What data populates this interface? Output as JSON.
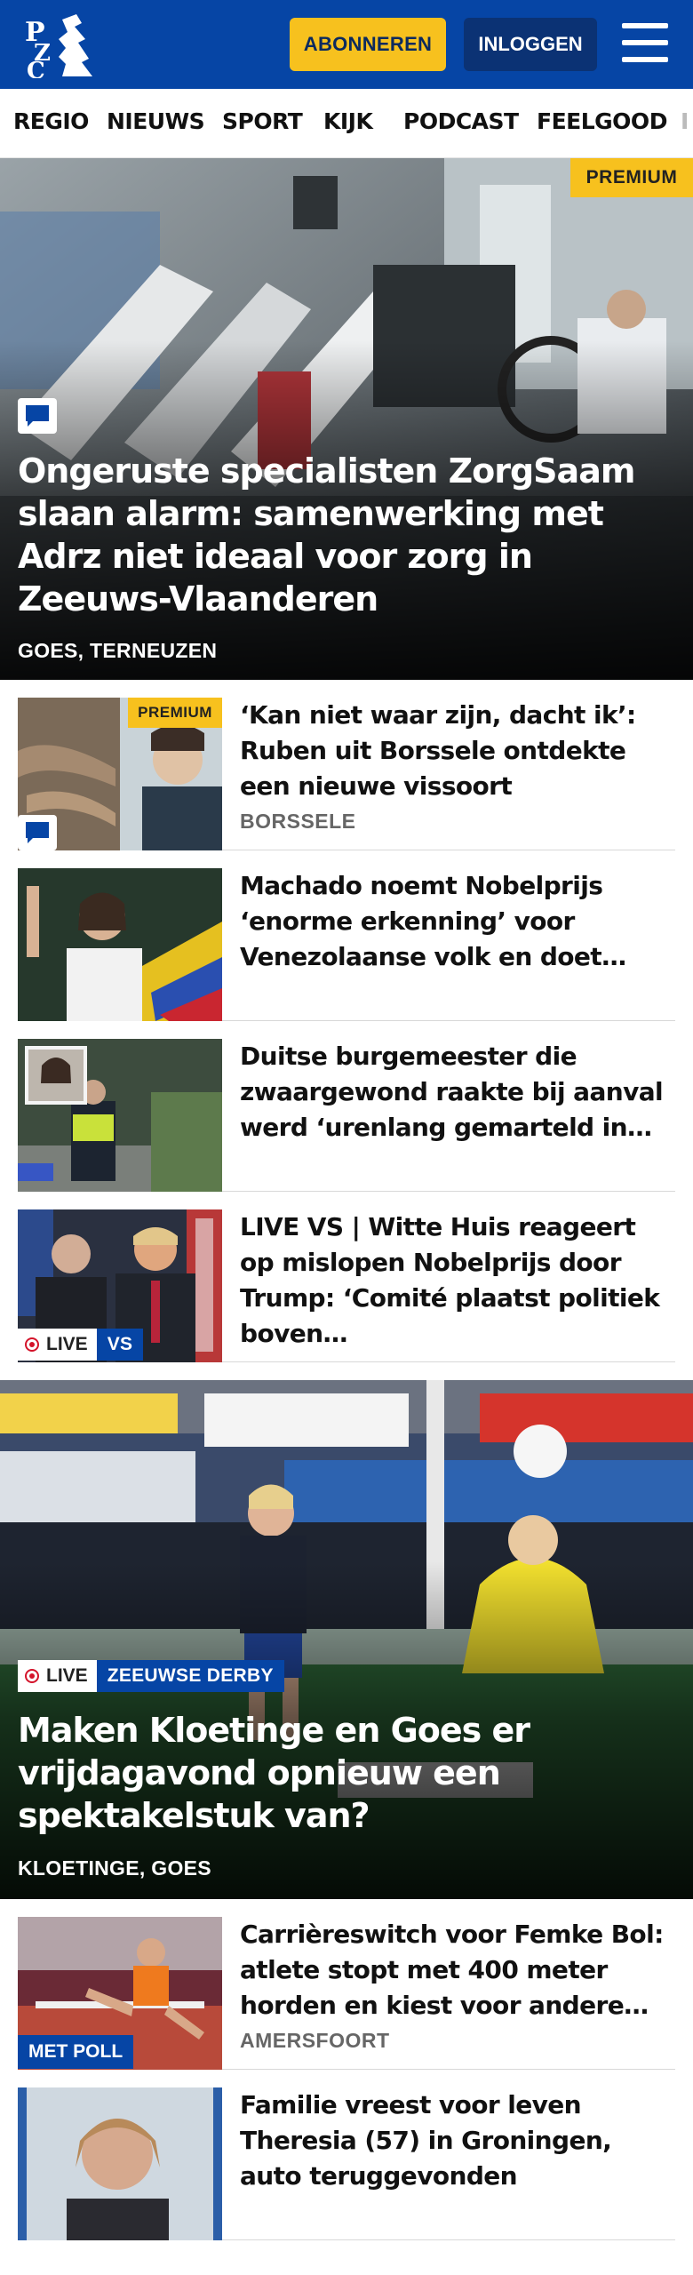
{
  "header": {
    "logo_text": "PZC",
    "subscribe_label": "ABONNEREN",
    "login_label": "INLOGGEN"
  },
  "nav": {
    "items": [
      "REGIO",
      "NIEUWS",
      "SPORT",
      "KIJK",
      "PODCAST",
      "FEELGOOD",
      "I"
    ]
  },
  "badges": {
    "premium": "PREMIUM",
    "live": "LIVE",
    "vs": "VS",
    "derby": "ZEEUWSE DERBY",
    "poll": "MET POLL"
  },
  "hero1": {
    "title": "Ongeruste specialisten ZorgSaam slaan alarm: samenwerking met Adrz niet ideaal voor zorg in Zeeuws-Vlaanderen",
    "location": "GOES, TERNEUZEN"
  },
  "articles": [
    {
      "title": "‘Kan niet waar zijn, dacht ik’: Ruben uit Borssele ontdekte een nieuwe vissoort",
      "location": "BORSSELE"
    },
    {
      "title": "Machado noemt Nobelprijs ‘enorme erkenning’ voor Venezolaanse volk en doet…",
      "location": ""
    },
    {
      "title": "Duitse burgemeester die zwaargewond raakte bij aanval werd ‘urenlang gemarteld in…",
      "location": ""
    },
    {
      "title": "LIVE VS | Witte Huis reageert op mislopen Nobelprijs door Trump: ‘Comité plaatst politiek boven…",
      "location": ""
    }
  ],
  "hero2": {
    "title": "Maken Kloetinge en Goes er vrijdag­avond opnieuw een spektakelstuk van?",
    "location": "KLOETINGE, GOES"
  },
  "articles2": [
    {
      "title": "Carrièreswitch voor Femke Bol: atlete stopt met 400 meter horden en kiest voor andere…",
      "location": "AMERSFOORT"
    },
    {
      "title": "Familie vreest voor leven Theresia (57) in Groningen, auto teruggevonden",
      "location": ""
    }
  ],
  "colors": {
    "brand_blue": "#0645a5",
    "accent_yellow": "#f7c11e",
    "live_red": "#d4132a"
  }
}
